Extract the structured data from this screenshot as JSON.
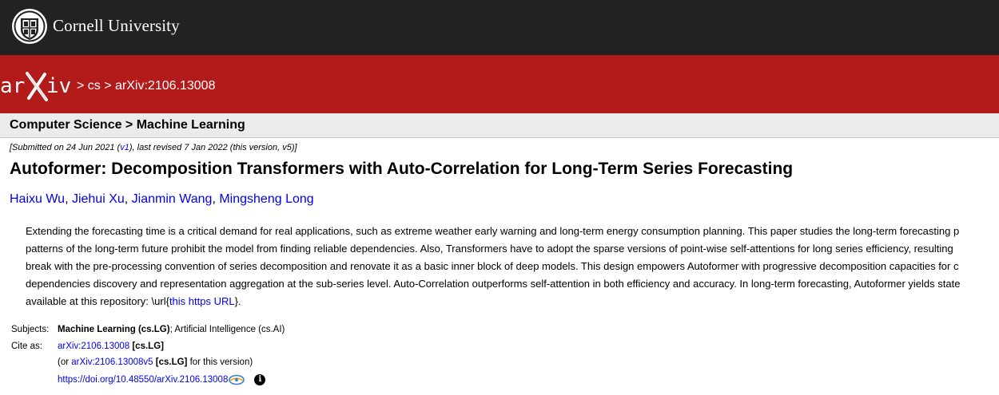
{
  "header": {
    "institution": "Cornell University"
  },
  "breadcrumb": {
    "sep1": " > ",
    "category": "cs",
    "sep2": " > ",
    "paper_id": "arXiv:2106.13008"
  },
  "subject_heading": "Computer Science > Machine Learning",
  "dateline": {
    "prefix": "[Submitted on 24 Jun 2021 (",
    "v1": "v1",
    "suffix": "), last revised 7 Jan 2022 (this version, v5)]"
  },
  "title": "Autoformer: Decomposition Transformers with Auto-Correlation for Long-Term Series Forecasting",
  "authors": [
    "Haixu Wu",
    "Jiehui Xu",
    "Jianmin Wang",
    "Mingsheng Long"
  ],
  "author_sep": ", ",
  "abstract": {
    "lines": [
      "Extending the forecasting time is a critical demand for real applications, such as extreme weather early warning and long-term energy consumption planning. This paper studies the long-term forecasting p",
      "patterns of the long-term future prohibit the model from finding reliable dependencies. Also, Transformers have to adopt the sparse versions of point-wise self-attentions for long series efficiency, resulting",
      "break with the pre-processing convention of series decomposition and renovate it as a basic inner block of deep models. This design empowers Autoformer with progressive decomposition capacities for c",
      "dependencies discovery and representation aggregation at the sub-series level. Auto-Correlation outperforms self-attention in both efficiency and accuracy. In long-term forecasting, Autoformer yields state"
    ],
    "last_prefix": "available at this repository: \\url{",
    "last_link": "this https URL",
    "last_suffix": "}."
  },
  "subjects": {
    "label": "Subjects:",
    "primary": "Machine Learning (cs.LG)",
    "rest": "; Artificial Intelligence (cs.AI)"
  },
  "cite": {
    "label": "Cite as:",
    "id": "arXiv:2106.13008",
    "tag": " [cs.LG]",
    "alt_prefix": "(or ",
    "alt_id": "arXiv:2106.13008v5",
    "alt_tag": " [cs.LG]",
    "alt_suffix": " for this version)",
    "doi": "https://doi.org/10.48550/arXiv.2106.13008",
    "info": "i"
  }
}
